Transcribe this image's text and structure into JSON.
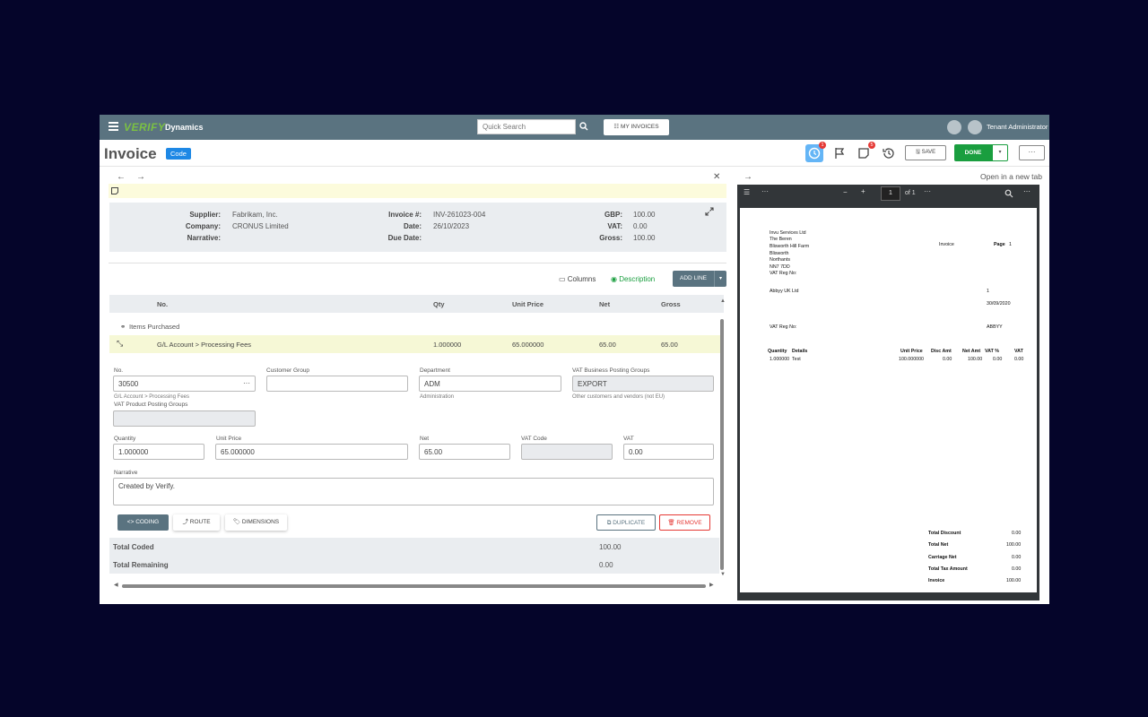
{
  "topbar": {
    "logo": "VERIFY",
    "brand": "Dynamics",
    "search_placeholder": "Quick Search",
    "my_invoices": "☷ MY INVOICES",
    "user": "Tenant Administrator"
  },
  "header": {
    "title": "Invoice",
    "code_badge": "Code",
    "clock_badge": "1",
    "notes_badge": "5",
    "save": "🖫 SAVE",
    "done": "DONE",
    "more": "···"
  },
  "summary": {
    "supplier_label": "Supplier:",
    "supplier": "Fabrikam, Inc.",
    "company_label": "Company:",
    "company": "CRONUS Limited",
    "narrative_label": "Narrative:",
    "invoice_label": "Invoice #:",
    "invoice": "INV-261023-004",
    "date_label": "Date:",
    "date": "26/10/2023",
    "due_label": "Due Date:",
    "currency_label": "GBP:",
    "currency_val": "100.00",
    "vat_label": "VAT:",
    "vat": "0.00",
    "gross_label": "Gross:",
    "gross": "100.00"
  },
  "toolbar": {
    "columns": "Columns",
    "description": "Description",
    "add_line": "ADD LINE"
  },
  "grid": {
    "headers": {
      "no": "No.",
      "qty": "Qty",
      "unit_price": "Unit Price",
      "net": "Net",
      "gross": "Gross"
    },
    "group": "Items Purchased",
    "line": {
      "no": "G/L Account > Processing Fees",
      "qty": "1.000000",
      "unit_price": "65.000000",
      "net": "65.00",
      "gross": "65.00"
    }
  },
  "form": {
    "no_label": "No.",
    "no_value": "30500",
    "no_hint": "G/L Account > Processing Fees",
    "customer_group_label": "Customer Group",
    "department_label": "Department",
    "department_value": "ADM",
    "department_hint": "Administration",
    "vat_bus_label": "VAT Business Posting Groups",
    "vat_bus_value": "EXPORT",
    "vat_bus_hint": "Other customers and vendors (not EU)",
    "vat_prod_label": "VAT Product Posting Groups",
    "quantity_label": "Quantity",
    "quantity_value": "1.000000",
    "unit_price_label": "Unit Price",
    "unit_price_value": "65.000000",
    "net_label": "Net",
    "net_value": "65.00",
    "vat_code_label": "VAT Code",
    "vat_label": "VAT",
    "vat_value": "0.00",
    "narrative_label": "Narrative",
    "narrative_value": "Created by Verify.",
    "coding": "<> CODING",
    "route": "⤴ ROUTE",
    "dimensions": "🏷 DIMENSIONS",
    "duplicate": "⧉ DUPLICATE",
    "remove": "🗑 REMOVE"
  },
  "totals": {
    "coded_label": "Total Coded",
    "coded_value": "100.00",
    "remaining_label": "Total Remaining",
    "remaining_value": "0.00"
  },
  "viewer": {
    "open_new_tab": "Open in a new tab",
    "page": "1",
    "of": "of 1"
  },
  "pdf_doc": {
    "from1": "Invu Services Ltd",
    "from2": "The Beren",
    "from3": "Blisworth Hill Farm",
    "from4": "Blisworth",
    "from5": "Northants",
    "from6": "NN7 7DD",
    "from7": "VAT Reg No:",
    "doc_title": "Invoice",
    "page_label": "Page",
    "page_num": "1",
    "to1": "Abbyy UK Ltd",
    "num": "1",
    "date": "30/09/2020",
    "vat_reg": "VAT Reg No:",
    "abbyy": "ABBYY",
    "h_qty": "Quantity",
    "h_details": "Details",
    "h_unit": "Unit Price",
    "h_disc": "Disc Amt",
    "h_net": "Net Amt",
    "h_vatp": "VAT %",
    "h_vat": "VAT",
    "r_qty": "1.000000",
    "r_details": "Test",
    "r_unit": "100.000000",
    "r_disc": "0.00",
    "r_net": "100.00",
    "r_vatp": "0.00",
    "r_vat": "0.00",
    "t_disc_l": "Total Discount",
    "t_disc": "0.00",
    "t_net_l": "Total Net",
    "t_net": "100.00",
    "t_carr_l": "Carriage Net",
    "t_carr": "0.00",
    "t_tax_l": "Total Tax Amount",
    "t_tax": "0.00",
    "t_inv_l": "Invoice",
    "t_inv": "100.00"
  },
  "colors": {
    "topbar": "#5a7380",
    "done": "#1a9e3f",
    "accent": "#1e88e5",
    "badge": "#e53935"
  }
}
